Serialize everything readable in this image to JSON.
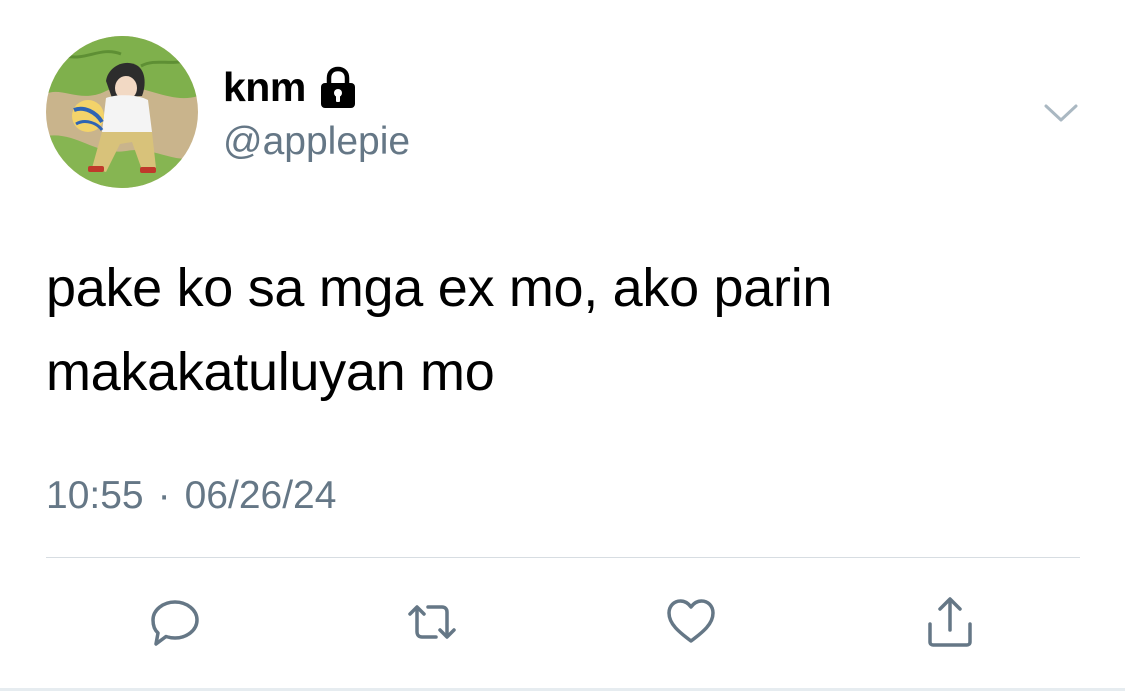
{
  "tweet": {
    "author": {
      "display_name": "knm",
      "handle": "@applepie",
      "protected": true,
      "avatar": "anime-volleyball-player-avatar"
    },
    "text_lines": [
      "pake ko sa mga ex mo, ako parin",
      "makakatuluyan mo"
    ],
    "time": "10:55",
    "separator": "·",
    "date": "06/26/24"
  },
  "icons": {
    "lock": "lock-icon",
    "menu": "chevron-down-icon",
    "reply": "comment-icon",
    "retweet": "retweet-icon",
    "like": "heart-icon",
    "share": "share-icon"
  },
  "colors": {
    "text": "#000000",
    "secondary": "#657786",
    "divider": "#d7dde2",
    "icon_gray": "#657786"
  }
}
